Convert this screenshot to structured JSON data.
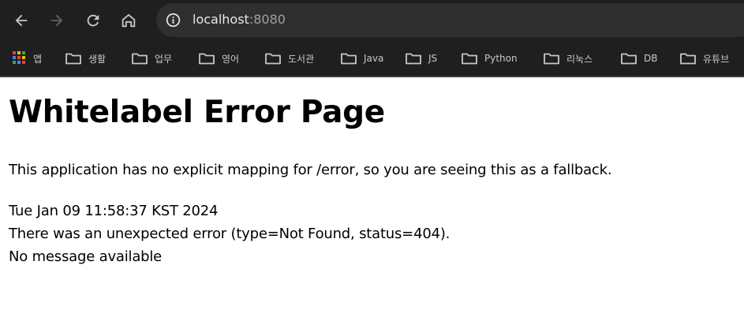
{
  "browser": {
    "url_host": "localhost",
    "url_port": ":8080",
    "colors": {
      "chrome_bg": "#1f1f1f",
      "omnibox_bg": "#2f2f2f",
      "icon_active": "#c4c7c5",
      "icon_disabled": "#5f6368"
    },
    "icons": [
      "back-arrow-icon",
      "forward-arrow-icon",
      "reload-icon",
      "home-icon",
      "info-icon",
      "folder-icon",
      "apps-grid-icon"
    ]
  },
  "bookmarks": [
    {
      "label": "앱",
      "icon": "apps-grid-icon"
    },
    {
      "label": "생활",
      "icon": "folder-icon"
    },
    {
      "label": "업무",
      "icon": "folder-icon"
    },
    {
      "label": "영어",
      "icon": "folder-icon"
    },
    {
      "label": "도서관",
      "icon": "folder-icon"
    },
    {
      "label": "Java",
      "icon": "folder-icon"
    },
    {
      "label": "JS",
      "icon": "folder-icon"
    },
    {
      "label": "Python",
      "icon": "folder-icon"
    },
    {
      "label": "리눅스",
      "icon": "folder-icon"
    },
    {
      "label": "DB",
      "icon": "folder-icon"
    },
    {
      "label": "유튜브",
      "icon": "folder-icon"
    }
  ],
  "page": {
    "title": "Whitelabel Error Page",
    "description": "This application has no explicit mapping for /error, so you are seeing this as a fallback.",
    "timestamp": "Tue Jan 09 11:58:37 KST 2024",
    "error_line": "There was an unexpected error (type=Not Found, status=404).",
    "message_line": "No message available"
  }
}
